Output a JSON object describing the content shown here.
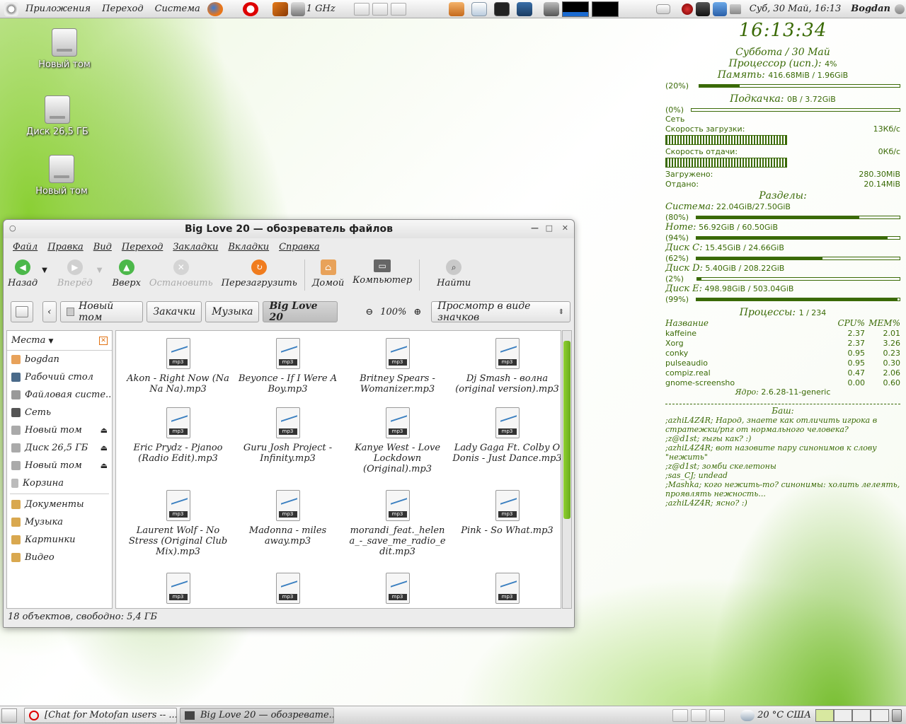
{
  "top_panel": {
    "menus": [
      "Приложения",
      "Переход",
      "Система"
    ],
    "cpu_freq": "1 GHz",
    "clock": "Суб, 30 Май, 16:13",
    "user": "Bogdan"
  },
  "desktop": {
    "icons": [
      "Новый том",
      "Диск 26,5 ГБ",
      "Новый том"
    ]
  },
  "window": {
    "title": "Big Love 20 — обозреватель файлов",
    "menu": [
      "Файл",
      "Правка",
      "Вид",
      "Переход",
      "Закладки",
      "Вкладки",
      "Справка"
    ],
    "toolbar": {
      "back": "Назад",
      "forward": "Вперёд",
      "up": "Вверх",
      "stop": "Остановить",
      "reload": "Перезагрузить",
      "home": "Домой",
      "computer": "Компьютер",
      "search": "Найти"
    },
    "path": [
      "Новый том",
      "Закачки",
      "Музыка",
      "Big Love 20"
    ],
    "zoom": "100%",
    "view_mode": "Просмотр в виде значков",
    "sidebar": {
      "title": "Места",
      "items": [
        "bogdan",
        "Рабочий стол",
        "Файловая систе...",
        "Сеть",
        "Новый том",
        "Диск 26,5 ГБ",
        "Новый том",
        "Корзина"
      ],
      "bookmarks": [
        "Документы",
        "Музыка",
        "Картинки",
        "Видео"
      ]
    },
    "files": [
      "Akon - Right Now (Na Na Na).mp3",
      "Beyonce - If I Were A Boy.mp3",
      "Britney Spears - Womanizer.mp3",
      "Dj Smash - волна (original version).mp3",
      "Eric Prydz - Pjanoo (Radio Edit).mp3",
      "Guru Josh Project - Infinity.mp3",
      "Kanye West - Love Lockdown (Original).mp3",
      "Lady Gaga Ft. Colby O Donis - Just Dance.mp3",
      "Laurent Wolf - No Stress (Original Club Mix).mp3",
      "Madonna - miles away.mp3",
      "morandi_feat._helena_-_save_me_radio_edit.mp3",
      "Pink - So What.mp3",
      "",
      "",
      "",
      ""
    ],
    "file_badge": "mp3",
    "status": "18 объектов, свободно: 5,4 ГБ"
  },
  "conky": {
    "time": "16:13:34",
    "date": "Суббота / 30 Май",
    "cpu_label": "Процессор (исп.):",
    "cpu": "4%",
    "mem_label": "Память:",
    "mem": "416.68MiB / 1.96GiB",
    "mem_pct": "(20%)",
    "mem_frac": 0.2,
    "swap_label": "Подкачка:",
    "swap": "0B / 3.72GiB",
    "swap_pct": "(0%)",
    "swap_frac": 0,
    "net_label": "Сеть",
    "down_label": "Скорость загрузки:",
    "down": "13Кб/с",
    "up_label": "Скорость отдачи:",
    "up": "0Кб/с",
    "total_down_label": "Загружено:",
    "total_down": "280.30MiB",
    "total_up_label": "Отдано:",
    "total_up": "20.14MiB",
    "parts_label": "Разделы:",
    "parts": [
      {
        "name": "Система:",
        "val": "22.04GiB/27.50GiB",
        "pct": "(80%)",
        "frac": 0.8
      },
      {
        "name": "Home:",
        "val": "56.92GiB  /  60.50GiB",
        "pct": "(94%)",
        "frac": 0.94
      },
      {
        "name": "Диск C:",
        "val": "15.45GiB  /  24.66GiB",
        "pct": "(62%)",
        "frac": 0.62
      },
      {
        "name": "Диск D:",
        "val": "5.40GiB  /  208.22GiB",
        "pct": "(2%)",
        "frac": 0.02
      },
      {
        "name": "Диск E:",
        "val": "498.98GiB  /  503.04GiB",
        "pct": "(99%)",
        "frac": 0.99
      }
    ],
    "proc_label": "Процессы:",
    "proc_count": "1 / 234",
    "proc_head": [
      "Название",
      "CPU%",
      "MEM%"
    ],
    "procs": [
      [
        "kaffeine",
        "2.37",
        "2.01"
      ],
      [
        "Xorg",
        "2.37",
        "3.26"
      ],
      [
        "conky",
        "0.95",
        "0.23"
      ],
      [
        "pulseaudio",
        "0.95",
        "0.30"
      ],
      [
        "compiz.real",
        "0.47",
        "2.06"
      ],
      [
        "gnome-screensho",
        "0.00",
        "0.60"
      ]
    ],
    "kernel_label": "Ядро:",
    "kernel": "2.6.28-11-generic",
    "bash_label": "Баш:",
    "bash": [
      ";azhiL4Z4R; Народ, знаете как отличить игрока в стратежки/рпг от нормального человека?",
      ";z@d1st; гыгы как? :)",
      ";azhiL4Z4R; вот назовите пару синонимов к слову \"нежить\"",
      ";z@d1st; зомби скелетоны",
      ";sas_CJ; undead",
      ";Mashka; кого нежить-то? синонимы: холить лелеять, проявлять нежность...",
      ";azhiL4Z4R; ясно? :)"
    ]
  },
  "taskbar": {
    "tasks": [
      "[Chat for Motofan users -- ...",
      "Big Love 20 — обозревате..."
    ],
    "weather": "20 °C США"
  }
}
